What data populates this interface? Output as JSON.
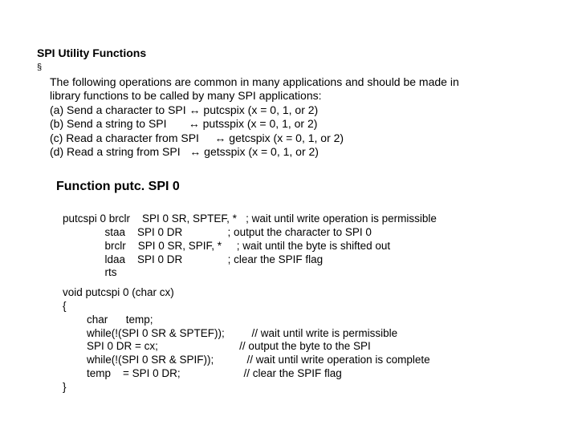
{
  "title": "SPI Utility Functions",
  "bullet": {
    "marker": "§",
    "line1": "The following operations are common in many applications and should be made in",
    "line2": "library functions to be called by many SPI applications:",
    "a": "(a) Send a character to SPI ↔ putcspix (x = 0, 1, or 2)",
    "b": "(b) Send a string to SPI       ↔ putsspix (x = 0, 1, or 2)",
    "c": "(c) Read a character from SPI     ↔ getcspix (x = 0, 1, or 2)",
    "d": "(d) Read a string from SPI   ↔ getsspix (x = 0, 1, or 2)"
  },
  "func_title": "Function putc. SPI 0",
  "asm": {
    "l1": "putcspi 0 brclr    SPI 0 SR, SPTEF, *   ; wait until write operation is permissible",
    "l2": "              staa    SPI 0 DR               ; output the character to SPI 0",
    "l3": "              brclr    SPI 0 SR, SPIF, *     ; wait until the byte is shifted out",
    "l4": "              ldaa    SPI 0 DR               ; clear the SPIF flag",
    "l5": "              rts"
  },
  "c": {
    "l1": "void putcspi 0 (char cx)",
    "l2": "{",
    "l3": "        char      temp;",
    "l4": "        while(!(SPI 0 SR & SPTEF));         // wait until write is permissible",
    "l5": "        SPI 0 DR = cx;                           // output the byte to the SPI",
    "l6": "        while(!(SPI 0 SR & SPIF));           // wait until write operation is complete",
    "l7": "        temp    = SPI 0 DR;                     // clear the SPIF flag",
    "l8": "}"
  }
}
